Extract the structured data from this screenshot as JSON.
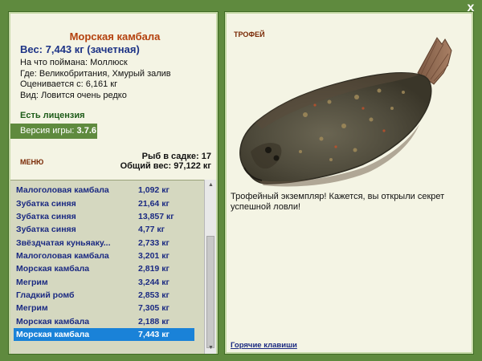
{
  "window": {
    "close_label": "x"
  },
  "fish": {
    "title": "Морская камбала",
    "weight": "Вес: 7,443 кг (зачетная)",
    "bait": "На что поймана: Моллюск",
    "location": "Где: Великобритания, Хмурый залив",
    "value": "Оценивается с: 6,161 кг",
    "rarity": "Вид: Ловится очень редко"
  },
  "license": "Есть лицензия",
  "version": {
    "label": "Версия игры:",
    "value": "3.7.6"
  },
  "menu_label": "МЕНЮ",
  "stats": {
    "fish_count": "Рыб в садке: 17",
    "total_weight": "Общий вес: 97,122 кг"
  },
  "catch_list": [
    {
      "name": "Малоголовая камбала",
      "weight": "1,092 кг"
    },
    {
      "name": "Зубатка синяя",
      "weight": "21,64 кг"
    },
    {
      "name": "Зубатка синяя",
      "weight": "13,857 кг"
    },
    {
      "name": "Зубатка синяя",
      "weight": "4,77 кг"
    },
    {
      "name": "Звёздчатая куньяаку...",
      "weight": "2,733 кг"
    },
    {
      "name": "Малоголовая камбала",
      "weight": "3,201 кг"
    },
    {
      "name": "Морская камбала",
      "weight": "2,819 кг"
    },
    {
      "name": "Мегрим",
      "weight": "3,244 кг"
    },
    {
      "name": "Гладкий ромб",
      "weight": "2,853 кг"
    },
    {
      "name": "Мегрим",
      "weight": "7,305 кг"
    },
    {
      "name": "Морская камбала",
      "weight": "2,188 кг"
    },
    {
      "name": "Морская камбала",
      "weight": "7,443 кг"
    }
  ],
  "selected_index": 11,
  "trophy": {
    "label": "ТРОФЕЙ",
    "text": "Трофейный экземпляр! Кажется, вы открыли секрет успешной ловли!"
  },
  "hotkeys_label": "Горячие клавиши",
  "colors": {
    "background": "#5f8a3e",
    "panel": "#f4f4e4",
    "title_orange": "#b4410e",
    "text_blue": "#1d3386",
    "selection": "#1a82d8"
  }
}
